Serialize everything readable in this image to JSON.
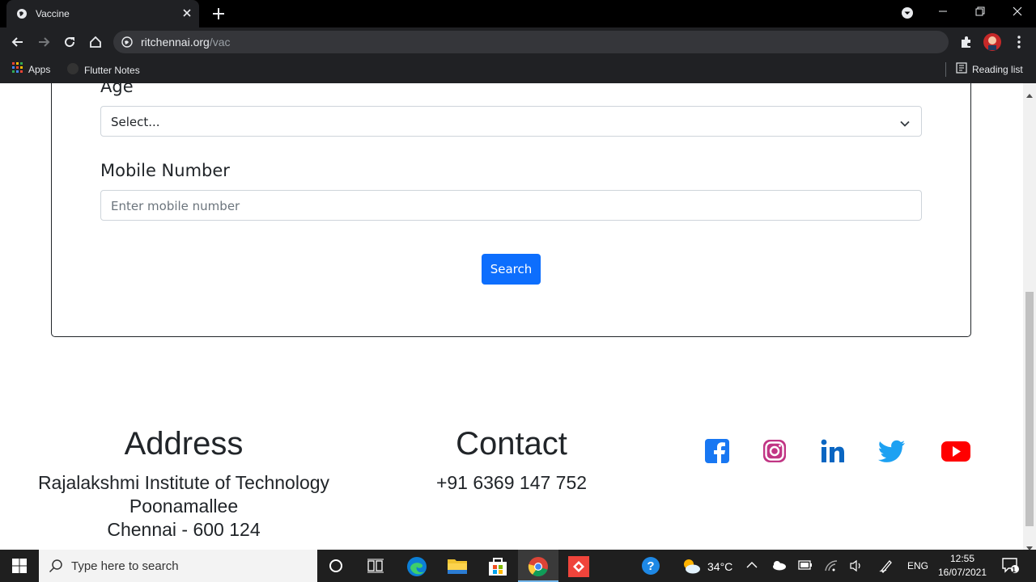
{
  "browser": {
    "tab_title": "Vaccine",
    "url_host": "ritchennai.org",
    "url_path": "/vac",
    "bookmarks": [
      "Apps",
      "Flutter Notes"
    ],
    "reading_list": "Reading list"
  },
  "form": {
    "age_label": "Age",
    "age_select_value": "Select...",
    "mobile_label": "Mobile Number",
    "mobile_placeholder": "Enter mobile number",
    "search_button": "Search"
  },
  "footer": {
    "address_heading": "Address",
    "address_line1": "Rajalakshmi Institute of Technology",
    "address_line2": "Poonamallee",
    "address_line3": "Chennai - 600 124",
    "contact_heading": "Contact",
    "contact_phone": "+91 6369 147 752",
    "social_icons": [
      "facebook-icon",
      "instagram-icon",
      "linkedin-icon",
      "twitter-icon",
      "youtube-icon"
    ]
  },
  "taskbar": {
    "search_placeholder": "Type here to search",
    "weather": "34°C",
    "language": "ENG",
    "time": "12:55",
    "date": "16/07/2021",
    "notification_count": "1"
  },
  "colors": {
    "primary_button": "#0d6efd",
    "facebook": "#1877f2",
    "instagram": "#c13584",
    "linkedin": "#0a66c2",
    "twitter": "#1da1f2",
    "youtube": "#ff0000"
  }
}
